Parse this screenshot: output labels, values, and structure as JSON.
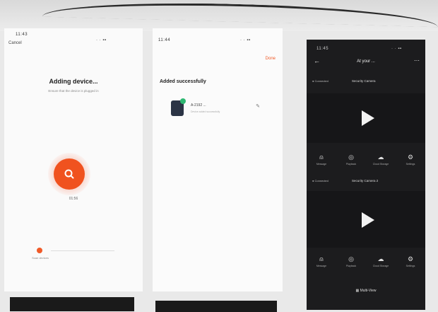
{
  "screen_left": {
    "status_left": "11:43",
    "status_right": "· · ▪▪",
    "cancel_label": "Cancel",
    "title": "Adding device...",
    "subtitle": "Ensure that the device is plugged in",
    "timer": "01:56",
    "step_label": "Scan devices"
  },
  "screen_mid": {
    "status_left": "11:44",
    "status_right": "· · ▪▪",
    "done_label": "Done",
    "title": "Added successfully",
    "device_name": "A-2192 ...",
    "device_sub": "Device added successfully"
  },
  "screen_right": {
    "status_left": "11:45",
    "status_right": "· · ▪▪",
    "title": "At your ...",
    "cameras": [
      {
        "status": "● Connected",
        "name": "Security Camera"
      },
      {
        "status": "● Connected",
        "name": "Security Camera 2"
      }
    ],
    "tools": [
      {
        "icon": "bell-icon",
        "label": "Message"
      },
      {
        "icon": "playback-icon",
        "label": "Playback"
      },
      {
        "icon": "cloud-icon",
        "label": "Cloud Storage"
      },
      {
        "icon": "gear-icon",
        "label": "Settings"
      }
    ],
    "multi_view_label": "Multi-View"
  },
  "colors": {
    "accent": "#f05a28",
    "success": "#2eb872",
    "dark_bg": "#1c1c1e"
  }
}
